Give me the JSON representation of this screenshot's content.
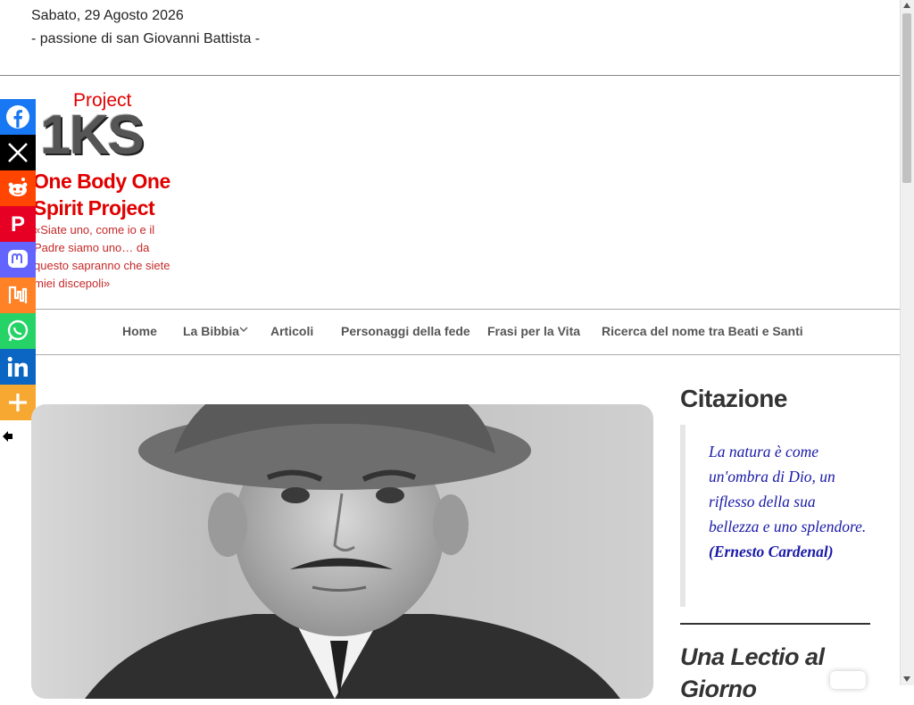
{
  "header": {
    "date": "Sabato, 29 Agosto 2026",
    "feast": "- passione di san Giovanni Battista -"
  },
  "logo": {
    "small_text": "Project",
    "mark_text": "1KS"
  },
  "site": {
    "title": "One Body One Spirit Project",
    "tagline": "«Siate uno, come io e il Padre siamo uno… da questo sapranno che siete miei discepoli»",
    "brand_color": "#e00000"
  },
  "nav": {
    "items": [
      {
        "label": "Home"
      },
      {
        "label": "La Bibbia"
      },
      {
        "label": "Articoli"
      },
      {
        "label": "Personaggi della fede"
      },
      {
        "label": "Frasi per la Vita"
      },
      {
        "label": "Ricerca del nome tra Beati e Santi"
      }
    ]
  },
  "social": {
    "buttons": [
      {
        "name": "facebook-icon",
        "color": "#1877f2"
      },
      {
        "name": "x-icon",
        "color": "#000000"
      },
      {
        "name": "reddit-icon",
        "color": "#ff4500"
      },
      {
        "name": "pinterest-icon",
        "color": "#e60023"
      },
      {
        "name": "mastodon-icon",
        "color": "#6364ff"
      },
      {
        "name": "mix-icon",
        "color": "#ff8226"
      },
      {
        "name": "whatsapp-icon",
        "color": "#25d366"
      },
      {
        "name": "linkedin-icon",
        "color": "#0a66c2"
      },
      {
        "name": "more-icon",
        "color": "#f7a831"
      }
    ]
  },
  "sidebar": {
    "quote_title": "Citazione",
    "quote_text": "La natura è come un'ombra di Dio, un riflesso della sua bellezza e uno splendore.",
    "quote_author": "(Ernesto Cardenal)",
    "next_title": "Una Lectio al Giorno",
    "quote_color": "#1a1aa8"
  }
}
